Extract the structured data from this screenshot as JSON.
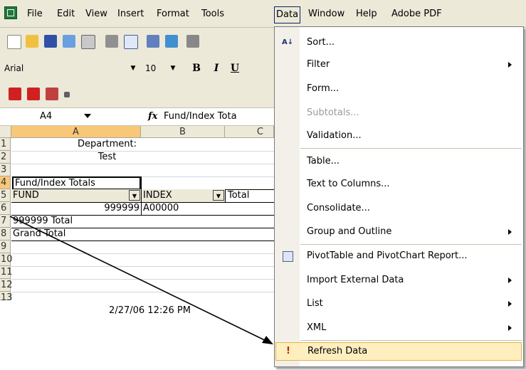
{
  "menubar": {
    "items": [
      {
        "label": "File"
      },
      {
        "label": "Edit"
      },
      {
        "label": "View"
      },
      {
        "label": "Insert"
      },
      {
        "label": "Format"
      },
      {
        "label": "Tools"
      },
      {
        "label": "Data"
      },
      {
        "label": "Window"
      },
      {
        "label": "Help"
      },
      {
        "label": "Adobe PDF"
      }
    ]
  },
  "format_toolbar": {
    "font": "Arial",
    "size": "10",
    "bold": "B",
    "italic": "I",
    "underline": "U"
  },
  "formula_bar": {
    "name_box": "A4",
    "fx": "fx",
    "content": "Fund/Index Tota"
  },
  "grid": {
    "columns": [
      "A",
      "B",
      "C"
    ],
    "rows": [
      "1",
      "2",
      "3",
      "4",
      "5",
      "6",
      "7",
      "8",
      "9",
      "10",
      "11",
      "12",
      "13"
    ],
    "cells": {
      "r1": "Department:",
      "r2": "Test",
      "r4": "Fund/Index Totals",
      "r5a": "FUND",
      "r5b": "INDEX",
      "r5c": "Total",
      "r6a": "999999",
      "r6b": "A00000",
      "r7": "999999 Total",
      "r8": "Grand Total",
      "r10": "2/27/06 12:26 PM"
    }
  },
  "data_menu": {
    "items": [
      {
        "label": "Sort...",
        "icon": "sort-az-icon"
      },
      {
        "label": "Filter",
        "submenu": true
      },
      {
        "label": "Form..."
      },
      {
        "label": "Subtotals...",
        "disabled": true
      },
      {
        "label": "Validation..."
      },
      {
        "label": "Table..."
      },
      {
        "label": "Text to Columns..."
      },
      {
        "label": "Consolidate..."
      },
      {
        "label": "Group and Outline",
        "submenu": true
      },
      {
        "label": "PivotTable and PivotChart Report...",
        "icon": "pivot-table-icon"
      },
      {
        "label": "Import External Data",
        "submenu": true
      },
      {
        "label": "List",
        "submenu": true
      },
      {
        "label": "XML",
        "submenu": true
      },
      {
        "label": "Refresh Data",
        "icon": "refresh-exclamation-icon",
        "highlighted": true
      }
    ]
  },
  "colors": {
    "menu_highlight": "#ffefbf",
    "selected_header": "#f8c878",
    "chrome": "#ece9d8"
  }
}
